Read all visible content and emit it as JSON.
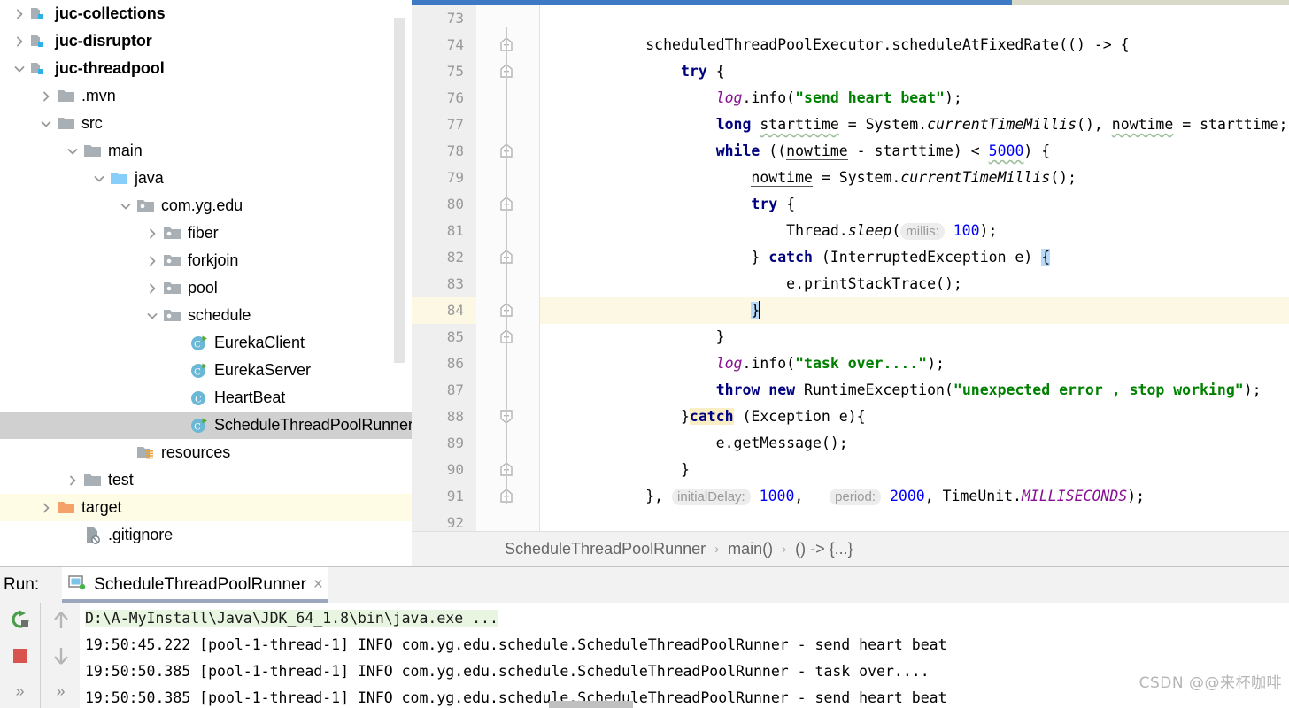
{
  "project_tree": {
    "rows": [
      {
        "label": "juc-collections",
        "indent": 0,
        "twisty": "right",
        "icon": "module-folder",
        "bold": true,
        "state": "normal"
      },
      {
        "label": "juc-disruptor",
        "indent": 0,
        "twisty": "right",
        "icon": "module-folder",
        "bold": true,
        "state": "normal"
      },
      {
        "label": "juc-threadpool",
        "indent": 0,
        "twisty": "down",
        "icon": "module-folder",
        "bold": true,
        "state": "normal"
      },
      {
        "label": ".mvn",
        "indent": 1,
        "twisty": "right",
        "icon": "folder",
        "bold": false,
        "state": "normal"
      },
      {
        "label": "src",
        "indent": 1,
        "twisty": "down",
        "icon": "folder",
        "bold": false,
        "state": "normal"
      },
      {
        "label": "main",
        "indent": 2,
        "twisty": "down",
        "icon": "folder",
        "bold": false,
        "state": "normal"
      },
      {
        "label": "java",
        "indent": 3,
        "twisty": "down",
        "icon": "source-folder",
        "bold": false,
        "state": "normal"
      },
      {
        "label": "com.yg.edu",
        "indent": 4,
        "twisty": "down",
        "icon": "package",
        "bold": false,
        "state": "normal"
      },
      {
        "label": "fiber",
        "indent": 5,
        "twisty": "right",
        "icon": "package",
        "bold": false,
        "state": "normal"
      },
      {
        "label": "forkjoin",
        "indent": 5,
        "twisty": "right",
        "icon": "package",
        "bold": false,
        "state": "normal"
      },
      {
        "label": "pool",
        "indent": 5,
        "twisty": "right",
        "icon": "package",
        "bold": false,
        "state": "normal"
      },
      {
        "label": "schedule",
        "indent": 5,
        "twisty": "down",
        "icon": "package",
        "bold": false,
        "state": "normal"
      },
      {
        "label": "EurekaClient",
        "indent": 6,
        "twisty": "none",
        "icon": "class-runnable",
        "bold": false,
        "state": "normal"
      },
      {
        "label": "EurekaServer",
        "indent": 6,
        "twisty": "none",
        "icon": "class-runnable",
        "bold": false,
        "state": "normal"
      },
      {
        "label": "HeartBeat",
        "indent": 6,
        "twisty": "none",
        "icon": "class",
        "bold": false,
        "state": "normal"
      },
      {
        "label": "ScheduleThreadPoolRunner",
        "indent": 6,
        "twisty": "none",
        "icon": "class-runnable",
        "bold": false,
        "state": "selected"
      },
      {
        "label": "resources",
        "indent": 4,
        "twisty": "none",
        "icon": "resources-folder",
        "bold": false,
        "state": "normal"
      },
      {
        "label": "test",
        "indent": 2,
        "twisty": "right",
        "icon": "folder",
        "bold": false,
        "state": "normal"
      },
      {
        "label": "target",
        "indent": 1,
        "twisty": "right",
        "icon": "excluded-folder",
        "bold": false,
        "state": "highlight"
      },
      {
        "label": ".gitignore",
        "indent": 2,
        "twisty": "none",
        "icon": "ignored-file",
        "bold": false,
        "state": "normal"
      }
    ]
  },
  "editor": {
    "first_line": 73,
    "current_line": 84,
    "lines": [
      {
        "n": 73,
        "fold": "none",
        "segments": []
      },
      {
        "n": 74,
        "fold": "start",
        "segments": [
          {
            "t": "            scheduledThreadPoolExecutor.",
            "c": ""
          },
          {
            "t": "scheduleAtFixedRate",
            "c": ""
          },
          {
            "t": "(() -> {",
            "c": ""
          }
        ]
      },
      {
        "n": 75,
        "fold": "start",
        "segments": [
          {
            "t": "                ",
            "c": ""
          },
          {
            "t": "try",
            "c": "kw"
          },
          {
            "t": " {",
            "c": ""
          }
        ]
      },
      {
        "n": 76,
        "fold": "none",
        "segments": [
          {
            "t": "                    ",
            "c": ""
          },
          {
            "t": "log",
            "c": "fld"
          },
          {
            "t": ".info(",
            "c": ""
          },
          {
            "t": "\"send heart beat\"",
            "c": "str"
          },
          {
            "t": ");",
            "c": ""
          }
        ]
      },
      {
        "n": 77,
        "fold": "none",
        "segments": [
          {
            "t": "                    ",
            "c": ""
          },
          {
            "t": "long",
            "c": "kw"
          },
          {
            "t": " ",
            "c": ""
          },
          {
            "t": "starttime",
            "c": "sq"
          },
          {
            "t": " = System.",
            "c": ""
          },
          {
            "t": "currentTimeMillis",
            "c": "stc"
          },
          {
            "t": "(), ",
            "c": ""
          },
          {
            "t": "nowtime",
            "c": "sq"
          },
          {
            "t": " = starttime;",
            "c": ""
          }
        ]
      },
      {
        "n": 78,
        "fold": "start",
        "segments": [
          {
            "t": "                    ",
            "c": ""
          },
          {
            "t": "while",
            "c": "kw"
          },
          {
            "t": " ((",
            "c": ""
          },
          {
            "t": "nowtime",
            "c": "und"
          },
          {
            "t": " - starttime) < ",
            "c": ""
          },
          {
            "t": "5000",
            "c": "num sq"
          },
          {
            "t": ") {",
            "c": ""
          }
        ]
      },
      {
        "n": 79,
        "fold": "none",
        "segments": [
          {
            "t": "                        ",
            "c": ""
          },
          {
            "t": "nowtime",
            "c": "und"
          },
          {
            "t": " = System.",
            "c": ""
          },
          {
            "t": "currentTimeMillis",
            "c": "stc"
          },
          {
            "t": "();",
            "c": ""
          }
        ]
      },
      {
        "n": 80,
        "fold": "start",
        "segments": [
          {
            "t": "                        ",
            "c": ""
          },
          {
            "t": "try",
            "c": "kw"
          },
          {
            "t": " {",
            "c": ""
          }
        ]
      },
      {
        "n": 81,
        "fold": "none",
        "segments": [
          {
            "t": "                            Thread.",
            "c": ""
          },
          {
            "t": "sleep",
            "c": "stc"
          },
          {
            "t": "(",
            "c": ""
          },
          {
            "t": "millis:",
            "c": "hint"
          },
          {
            "t": " ",
            "c": ""
          },
          {
            "t": "100",
            "c": "num"
          },
          {
            "t": ");",
            "c": ""
          }
        ]
      },
      {
        "n": 82,
        "fold": "start",
        "segments": [
          {
            "t": "                        } ",
            "c": ""
          },
          {
            "t": "catch",
            "c": "kw"
          },
          {
            "t": " (InterruptedException e) ",
            "c": ""
          },
          {
            "t": "{",
            "c": "brace-hl"
          }
        ]
      },
      {
        "n": 83,
        "fold": "none",
        "segments": [
          {
            "t": "                            e.printStackTrace();",
            "c": ""
          }
        ]
      },
      {
        "n": 84,
        "fold": "start",
        "segments": [
          {
            "t": "                        ",
            "c": ""
          },
          {
            "t": "}",
            "c": "brace-hl"
          },
          {
            "t": "CARET",
            "c": "caret"
          }
        ]
      },
      {
        "n": 85,
        "fold": "start",
        "segments": [
          {
            "t": "                    }",
            "c": ""
          }
        ]
      },
      {
        "n": 86,
        "fold": "none",
        "segments": [
          {
            "t": "                    ",
            "c": ""
          },
          {
            "t": "log",
            "c": "fld"
          },
          {
            "t": ".info(",
            "c": ""
          },
          {
            "t": "\"task over....\"",
            "c": "str"
          },
          {
            "t": ");",
            "c": ""
          }
        ]
      },
      {
        "n": 87,
        "fold": "none",
        "segments": [
          {
            "t": "                    ",
            "c": ""
          },
          {
            "t": "throw new",
            "c": "kw"
          },
          {
            "t": " RuntimeException(",
            "c": ""
          },
          {
            "t": "\"unexpected error , stop working\"",
            "c": "str"
          },
          {
            "t": ");",
            "c": ""
          }
        ]
      },
      {
        "n": 88,
        "fold": "end",
        "segments": [
          {
            "t": "                }",
            "c": ""
          },
          {
            "t": "catch",
            "c": "kw catch-hl"
          },
          {
            "t": " (Exception e){",
            "c": ""
          }
        ]
      },
      {
        "n": 89,
        "fold": "none",
        "segments": [
          {
            "t": "                    e.getMessage();",
            "c": ""
          }
        ]
      },
      {
        "n": 90,
        "fold": "start",
        "segments": [
          {
            "t": "                }",
            "c": ""
          }
        ]
      },
      {
        "n": 91,
        "fold": "start",
        "segments": [
          {
            "t": "            }, ",
            "c": ""
          },
          {
            "t": "initialDelay:",
            "c": "hint"
          },
          {
            "t": " ",
            "c": ""
          },
          {
            "t": "1000",
            "c": "num"
          },
          {
            "t": ",   ",
            "c": ""
          },
          {
            "t": "period:",
            "c": "hint"
          },
          {
            "t": " ",
            "c": ""
          },
          {
            "t": "2000",
            "c": "num"
          },
          {
            "t": ", TimeUnit.",
            "c": ""
          },
          {
            "t": "MILLISECONDS",
            "c": "fld stc"
          },
          {
            "t": ");",
            "c": ""
          }
        ]
      },
      {
        "n": 92,
        "fold": "none",
        "segments": []
      }
    ],
    "breadcrumb": [
      {
        "label": "ScheduleThreadPoolRunner"
      },
      {
        "label": "main()"
      },
      {
        "label": "() -> {...}"
      }
    ],
    "breadcrumb_separator": "›"
  },
  "run_panel": {
    "label": "Run:",
    "tab_label": "ScheduleThreadPoolRunner",
    "close_glyph": "×",
    "toolbar": [
      {
        "name": "rerun-button",
        "glyph": "rerun"
      },
      {
        "name": "stop-button",
        "glyph": "stop"
      },
      {
        "name": "more-left-button",
        "glyph": "»"
      },
      {
        "name": "scroll-up-button",
        "glyph": "↑"
      },
      {
        "name": "scroll-down-button",
        "glyph": "↓"
      },
      {
        "name": "more-right-button",
        "glyph": "»"
      }
    ],
    "console_lines": [
      {
        "type": "command",
        "text": "D:\\A-MyInstall\\Java\\JDK_64_1.8\\bin\\java.exe ..."
      },
      {
        "type": "log",
        "text": "19:50:45.222 [pool-1-thread-1] INFO com.yg.edu.schedule.ScheduleThreadPoolRunner - send heart beat"
      },
      {
        "type": "log",
        "text": "19:50:50.385 [pool-1-thread-1] INFO com.yg.edu.schedule.ScheduleThreadPoolRunner - task over...."
      },
      {
        "type": "log",
        "text": "19:50:50.385 [pool-1-thread-1] INFO com.yg.edu.schedule.ScheduleThreadPoolRunner - send heart beat"
      }
    ]
  },
  "watermark": "CSDN @@来杯咖啡",
  "colors": {
    "tab_accent": "#3c7bc4",
    "selection": "#d0d0d0",
    "current_line": "#fdf8e3",
    "keyword": "#000080",
    "string": "#008000",
    "number": "#0000ff",
    "field": "#871094",
    "brace_match": "#b8d9f7",
    "catch_highlight": "#faeec4",
    "excluded_folder": "#f4a26a",
    "source_folder": "#87cefa",
    "class_icon": "#6bb8d6",
    "run_green": "#4a9e4a",
    "stop_red": "#d9534f"
  }
}
